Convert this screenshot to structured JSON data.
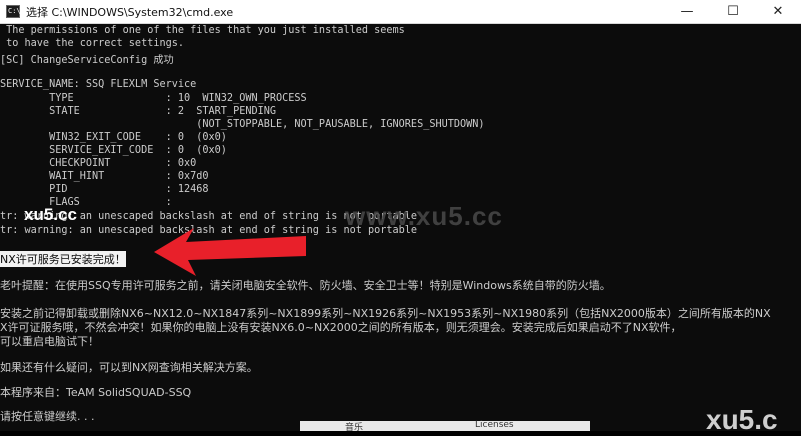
{
  "window": {
    "title": "选择 C:\\WINDOWS\\System32\\cmd.exe",
    "icon": "cmd-icon",
    "minimize": "—",
    "maximize": "☐",
    "close": "✕"
  },
  "console": {
    "lines": [
      " The permissions of one of the files that you just installed seems",
      " to have the correct settings.",
      "[SC] ChangeServiceConfig 成功",
      "",
      "SERVICE_NAME: SSQ FLEXLM Service",
      "        TYPE               : 10  WIN32_OWN_PROCESS",
      "        STATE              : 2  START_PENDING",
      "                                (NOT_STOPPABLE, NOT_PAUSABLE, IGNORES_SHUTDOWN)",
      "        WIN32_EXIT_CODE    : 0  (0x0)",
      "        SERVICE_EXIT_CODE  : 0  (0x0)",
      "        CHECKPOINT         : 0x0",
      "        WAIT_HINT          : 0x7d0",
      "        PID                : 12468",
      "        FLAGS              :",
      "tr: warning: an unescaped backslash at end of string is not portable",
      "tr: warning: an unescaped backslash at end of string is not portable"
    ],
    "installed_msg": "NX许可服务已安装完成！",
    "tip": "老叶提醒：在使用SSQ专用许可服务之前，请关闭电脑安全软件、防火墙、安全卫士等！特别是Windows系统自带的防火墙。",
    "uninstall_1": "安装之前记得卸载或删除NX6~NX12.0~NX1847系列~NX1899系列~NX1926系列~NX1953系列~NX1980系列（包括NX2000版本）之间所有版本的NX",
    "uninstall_2": "X许可证服务哦，不然会冲突！如果你的电脑上没有安装NX6.0~NX2000之间的所有版本，则无须理会。安装完成后如果启动不了NX软件，",
    "uninstall_3": "可以重启电脑试下！",
    "question": "如果还有什么疑问，可以到NX网查询相关解决方案。",
    "source": "本程序来自：TeAM SolidSQUAD-SSQ",
    "press_key": "请按任意键继续. . ."
  },
  "watermarks": {
    "left": "xu5.cc",
    "center": "www.xu5.cc",
    "corner": "xu5.c"
  },
  "taskbar": {
    "item1": "音乐",
    "item2": "Licenses"
  },
  "colors": {
    "console_bg": "#0c0c0c",
    "console_text": "#cccccc",
    "arrow": "#e8202a"
  }
}
